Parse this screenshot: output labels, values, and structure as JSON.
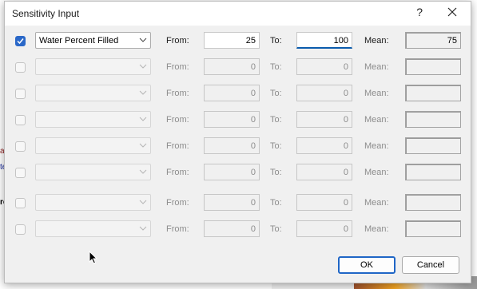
{
  "background": {
    "fragments": [
      "at",
      "te",
      "re"
    ]
  },
  "dialog": {
    "title": "Sensitivity Input",
    "help_label": "?",
    "rows": [
      {
        "checked": true,
        "enabled": true,
        "variable": "Water Percent Filled",
        "from_label": "From:",
        "from": "25",
        "to_label": "To:",
        "to": "100",
        "mean_label": "Mean:",
        "mean": "75"
      },
      {
        "checked": false,
        "enabled": false,
        "variable": "",
        "from_label": "From:",
        "from": "0",
        "to_label": "To:",
        "to": "0",
        "mean_label": "Mean:",
        "mean": ""
      },
      {
        "checked": false,
        "enabled": false,
        "variable": "",
        "from_label": "From:",
        "from": "0",
        "to_label": "To:",
        "to": "0",
        "mean_label": "Mean:",
        "mean": ""
      },
      {
        "checked": false,
        "enabled": false,
        "variable": "",
        "from_label": "From:",
        "from": "0",
        "to_label": "To:",
        "to": "0",
        "mean_label": "Mean:",
        "mean": ""
      },
      {
        "checked": false,
        "enabled": false,
        "variable": "",
        "from_label": "From:",
        "from": "0",
        "to_label": "To:",
        "to": "0",
        "mean_label": "Mean:",
        "mean": ""
      },
      {
        "checked": false,
        "enabled": false,
        "variable": "",
        "from_label": "From:",
        "from": "0",
        "to_label": "To:",
        "to": "0",
        "mean_label": "Mean:",
        "mean": ""
      },
      {
        "checked": false,
        "enabled": false,
        "variable": "",
        "from_label": "From:",
        "from": "0",
        "to_label": "To:",
        "to": "0",
        "mean_label": "Mean:",
        "mean": ""
      },
      {
        "checked": false,
        "enabled": false,
        "variable": "",
        "from_label": "From:",
        "from": "0",
        "to_label": "To:",
        "to": "0",
        "mean_label": "Mean:",
        "mean": ""
      }
    ],
    "ok_label": "OK",
    "cancel_label": "Cancel"
  },
  "icons": {
    "close": "close-icon",
    "dropdown": "chevron-down-icon",
    "check": "checkmark-icon",
    "cursor": "mouse-pointer-icon"
  },
  "colors": {
    "accent": "#2a68c8",
    "focus_underline": "#0b5cad"
  }
}
